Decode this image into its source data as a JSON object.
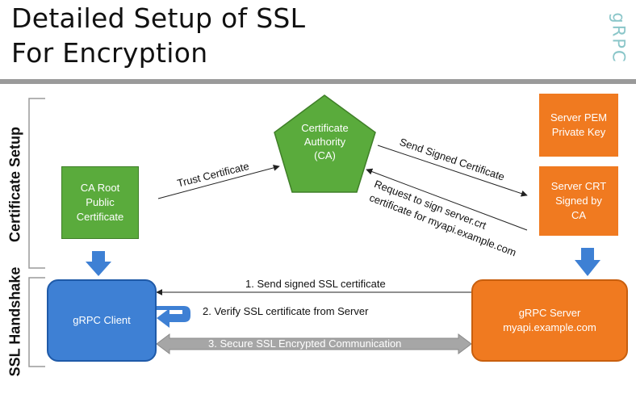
{
  "title": {
    "line1": "Detailed Setup of SSL",
    "line2": "For Encryption"
  },
  "logo": "gRPC",
  "sections": {
    "certificate_setup": "Certificate Setup",
    "ssl_handshake": "SSL Handshake"
  },
  "nodes": {
    "ca_root": "CA Root\nPublic\nCertificate",
    "certificate_authority": "Certificate\nAuthority\n(CA)",
    "server_pem": "Server PEM\nPrivate Key",
    "server_crt": "Server CRT\nSigned by\nCA",
    "grpc_client": "gRPC Client",
    "grpc_server": "gRPC Server\nmyapi.example.com"
  },
  "edges": {
    "trust_certificate": "Trust Certificate",
    "send_signed_certificate": "Send Signed Certificate",
    "request_sign_line1": "Request to sign server.crt",
    "request_sign_line2": "certificate for myapi.example.com",
    "step1": "1. Send signed SSL certificate",
    "step2": "2. Verify SSL certificate from Server",
    "step3": "3. Secure SSL Encrypted Communication"
  },
  "colors": {
    "green": "#5aab3c",
    "orange": "#f07a20",
    "blue": "#3e80d4",
    "gray_arrow": "#a6a6a6",
    "logo": "#8ac6c9"
  }
}
